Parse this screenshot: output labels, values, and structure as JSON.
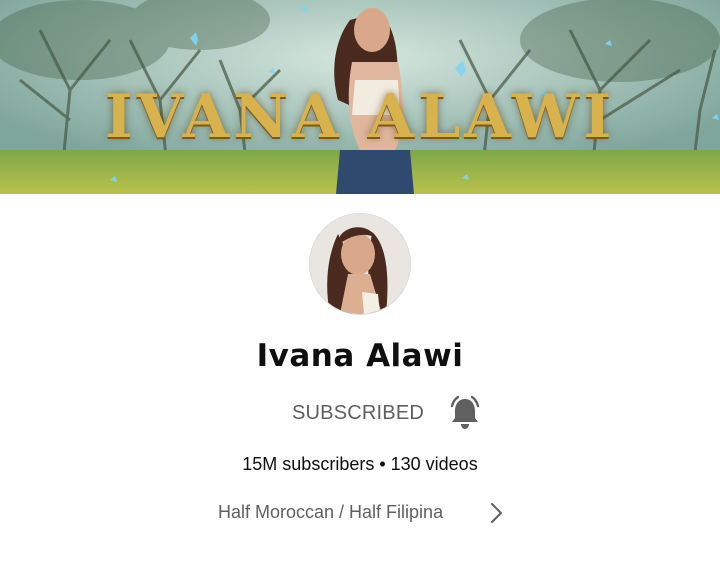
{
  "banner": {
    "title": "IVANA ALAWI"
  },
  "channel": {
    "name": "Ivana Alawi",
    "subscribe_status": "SUBSCRIBED",
    "stats": "15M subscribers • 130 videos",
    "description": "Half Moroccan / Half Filipina"
  },
  "icons": {
    "bell": "notification-bell-icon",
    "chevron": "chevron-right-icon"
  },
  "colors": {
    "title_gold": "#d8b24c",
    "secondary_text": "#606060",
    "primary_text": "#0f0f0f"
  }
}
